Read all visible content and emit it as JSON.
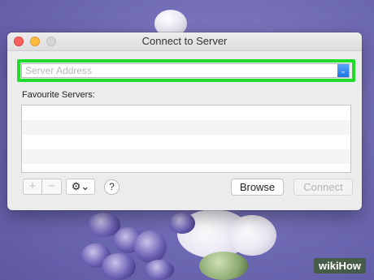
{
  "window": {
    "title": "Connect to Server"
  },
  "address": {
    "placeholder": "Server Address",
    "value": ""
  },
  "favourites": {
    "label": "Favourite Servers:",
    "rows": [
      "",
      "",
      "",
      ""
    ]
  },
  "toolbar": {
    "add_label": "+",
    "remove_label": "−",
    "gear_label": "⚙︎⌄",
    "help_label": "?"
  },
  "buttons": {
    "browse": "Browse",
    "connect": "Connect"
  },
  "watermark": "wikiHow",
  "colors": {
    "highlight": "#1fdc2a",
    "dropdown_accent": "#1f74e6"
  }
}
